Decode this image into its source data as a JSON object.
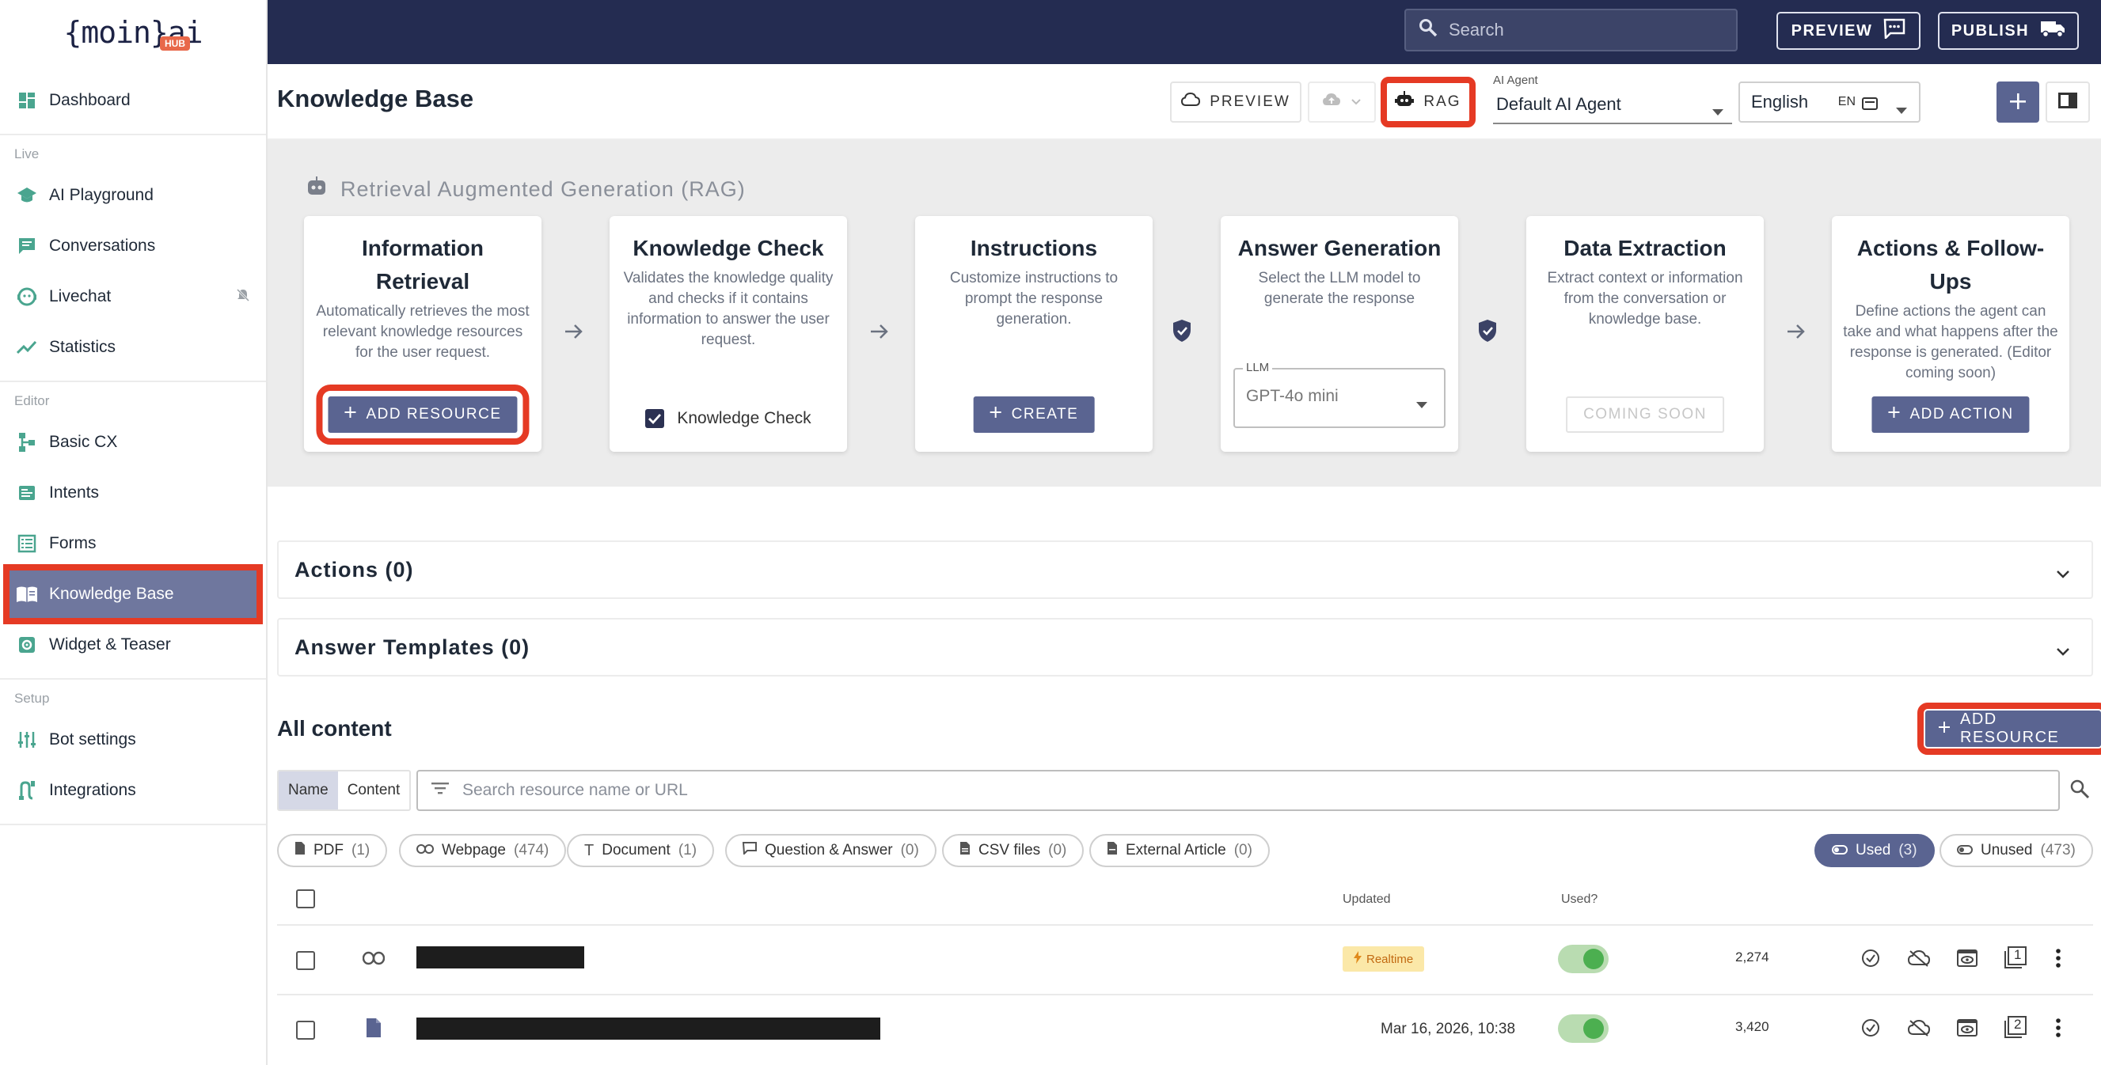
{
  "app": {
    "logo": "{moin}ai",
    "logo_badge": "HUB"
  },
  "sidebar": {
    "items": [
      {
        "label": "Dashboard"
      },
      {
        "section": "Live"
      },
      {
        "label": "AI Playground"
      },
      {
        "label": "Conversations"
      },
      {
        "label": "Livechat"
      },
      {
        "label": "Statistics"
      },
      {
        "section": "Editor"
      },
      {
        "label": "Basic CX"
      },
      {
        "label": "Intents"
      },
      {
        "label": "Forms"
      },
      {
        "label": "Knowledge Base"
      },
      {
        "label": "Widget & Teaser"
      },
      {
        "section": "Setup"
      },
      {
        "label": "Bot settings"
      },
      {
        "label": "Integrations"
      }
    ]
  },
  "topbar": {
    "search_placeholder": "Search",
    "preview": "PREVIEW",
    "publish": "PUBLISH"
  },
  "header": {
    "title": "Knowledge Base",
    "preview": "PREVIEW",
    "rag": "RAG",
    "agent_label": "AI Agent",
    "agent_value": "Default AI Agent",
    "language": "English",
    "language_code": "EN"
  },
  "rag": {
    "title": "Retrieval Augmented Generation (RAG)",
    "cards": [
      {
        "title": "Information Retrieval",
        "desc": "Automatically retrieves the most relevant knowledge resources for the user request.",
        "button": "ADD RESOURCE"
      },
      {
        "title": "Knowledge Check",
        "desc": "Validates the knowledge quality and checks if it contains information to answer the user request.",
        "checkbox": "Knowledge Check"
      },
      {
        "title": "Instructions",
        "desc": "Customize instructions to prompt the response generation.",
        "button": "CREATE"
      },
      {
        "title": "Answer Generation",
        "desc": "Select the LLM model to generate the response",
        "llm_label": "LLM",
        "llm_value": "GPT-4o mini"
      },
      {
        "title": "Data Extraction",
        "desc": "Extract context or information from the conversation or knowledge base.",
        "button": "COMING SOON"
      },
      {
        "title": "Actions & Follow-Ups",
        "desc": "Define actions the agent can take and what happens after the response is generated. (Editor coming soon)",
        "button": "ADD ACTION"
      }
    ]
  },
  "panels": {
    "actions": "Actions (0)",
    "templates": "Answer Templates (0)"
  },
  "content": {
    "title": "All content",
    "add_resource": "ADD RESOURCE",
    "seg_name": "Name",
    "seg_content": "Content",
    "search_placeholder": "Search resource name or URL",
    "filters": [
      {
        "label": "PDF",
        "count": "(1)"
      },
      {
        "label": "Webpage",
        "count": "(474)"
      },
      {
        "label": "Document",
        "count": "(1)"
      },
      {
        "label": "Question & Answer",
        "count": "(0)"
      },
      {
        "label": "CSV files",
        "count": "(0)"
      },
      {
        "label": "External Article",
        "count": "(0)"
      }
    ],
    "used": {
      "label": "Used",
      "count": "(3)"
    },
    "unused": {
      "label": "Unused",
      "count": "(473)"
    },
    "columns": {
      "updated": "Updated",
      "used": "Used?"
    },
    "rows": [
      {
        "updated": "Realtime",
        "number": "2,274",
        "page": "1"
      },
      {
        "updated": "Mar 16, 2026, 10:38",
        "number": "3,420",
        "page": "2"
      }
    ]
  }
}
